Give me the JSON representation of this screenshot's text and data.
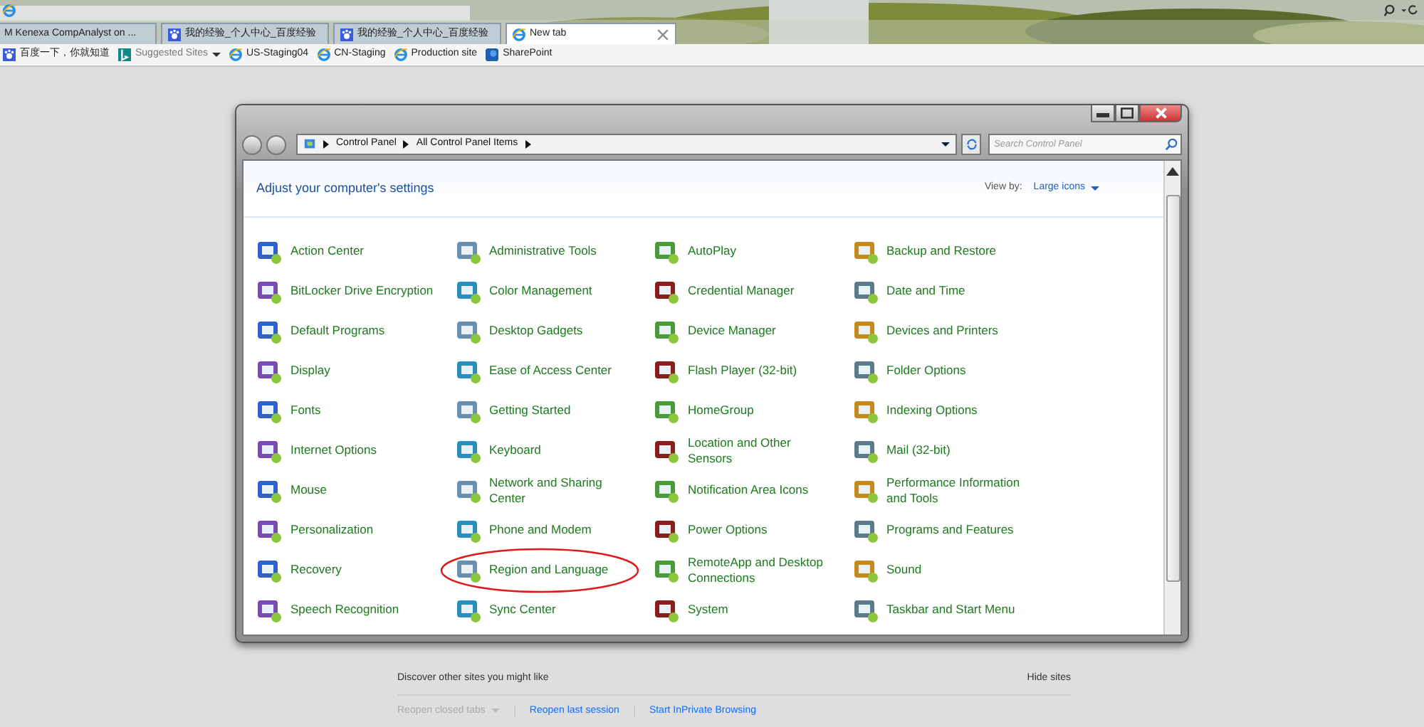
{
  "browser": {
    "tabs": [
      {
        "label": "M Kenexa CompAnalyst on ...",
        "selected": false
      },
      {
        "label": "我的经验_个人中心_百度经验",
        "selected": false
      },
      {
        "label": "我的经验_个人中心_百度经验",
        "selected": false
      },
      {
        "label": "New tab",
        "selected": true
      }
    ],
    "favorites": [
      {
        "label": "百度一下，你就知道",
        "dropdown": false
      },
      {
        "label": "Suggested Sites",
        "dropdown": true
      },
      {
        "label": "US-Staging04",
        "dropdown": false
      },
      {
        "label": "CN-Staging",
        "dropdown": false
      },
      {
        "label": "Production site",
        "dropdown": false
      },
      {
        "label": "SharePoint",
        "dropdown": false
      }
    ]
  },
  "window": {
    "breadcrumb": [
      "Control Panel",
      "All Control Panel Items"
    ],
    "search": {
      "placeholder": "Search Control Panel"
    },
    "heading": "Adjust your computer's settings",
    "view_by_label": "View by:",
    "view_by_value": "Large icons"
  },
  "items": [
    {
      "label": "Action Center",
      "circled": false
    },
    {
      "label": "Administrative Tools",
      "circled": false
    },
    {
      "label": "AutoPlay",
      "circled": false
    },
    {
      "label": "Backup and Restore",
      "circled": false
    },
    {
      "label": "BitLocker Drive Encryption",
      "circled": false
    },
    {
      "label": "Color Management",
      "circled": false
    },
    {
      "label": "Credential Manager",
      "circled": false
    },
    {
      "label": "Date and Time",
      "circled": false
    },
    {
      "label": "Default Programs",
      "circled": false
    },
    {
      "label": "Desktop Gadgets",
      "circled": false
    },
    {
      "label": "Device Manager",
      "circled": false
    },
    {
      "label": "Devices and Printers",
      "circled": false
    },
    {
      "label": "Display",
      "circled": false
    },
    {
      "label": "Ease of Access Center",
      "circled": false
    },
    {
      "label": "Flash Player (32-bit)",
      "circled": false
    },
    {
      "label": "Folder Options",
      "circled": false
    },
    {
      "label": "Fonts",
      "circled": false
    },
    {
      "label": "Getting Started",
      "circled": false
    },
    {
      "label": "HomeGroup",
      "circled": false
    },
    {
      "label": "Indexing Options",
      "circled": false
    },
    {
      "label": "Internet Options",
      "circled": false
    },
    {
      "label": "Keyboard",
      "circled": false
    },
    {
      "label": "Location and Other Sensors",
      "circled": false
    },
    {
      "label": "Mail (32-bit)",
      "circled": false
    },
    {
      "label": "Mouse",
      "circled": false
    },
    {
      "label": "Network and Sharing Center",
      "circled": false
    },
    {
      "label": "Notification Area Icons",
      "circled": false
    },
    {
      "label": "Performance Information and Tools",
      "circled": false
    },
    {
      "label": "Personalization",
      "circled": false
    },
    {
      "label": "Phone and Modem",
      "circled": false
    },
    {
      "label": "Power Options",
      "circled": false
    },
    {
      "label": "Programs and Features",
      "circled": false
    },
    {
      "label": "Recovery",
      "circled": false
    },
    {
      "label": "Region and Language",
      "circled": true
    },
    {
      "label": "RemoteApp and Desktop Connections",
      "circled": false
    },
    {
      "label": "Sound",
      "circled": false
    },
    {
      "label": "Speech Recognition",
      "circled": false
    },
    {
      "label": "Sync Center",
      "circled": false
    },
    {
      "label": "System",
      "circled": false
    },
    {
      "label": "Taskbar and Start Menu",
      "circled": false
    }
  ],
  "new_tab_page": {
    "discover": "Discover other sites you might like",
    "hide": "Hide sites",
    "actions": [
      {
        "label": "Reopen closed tabs",
        "disabled": true,
        "dropdown": true
      },
      {
        "label": "Reopen last session",
        "disabled": false,
        "dropdown": false
      },
      {
        "label": "Start InPrivate Browsing",
        "disabled": false,
        "dropdown": false
      }
    ]
  }
}
